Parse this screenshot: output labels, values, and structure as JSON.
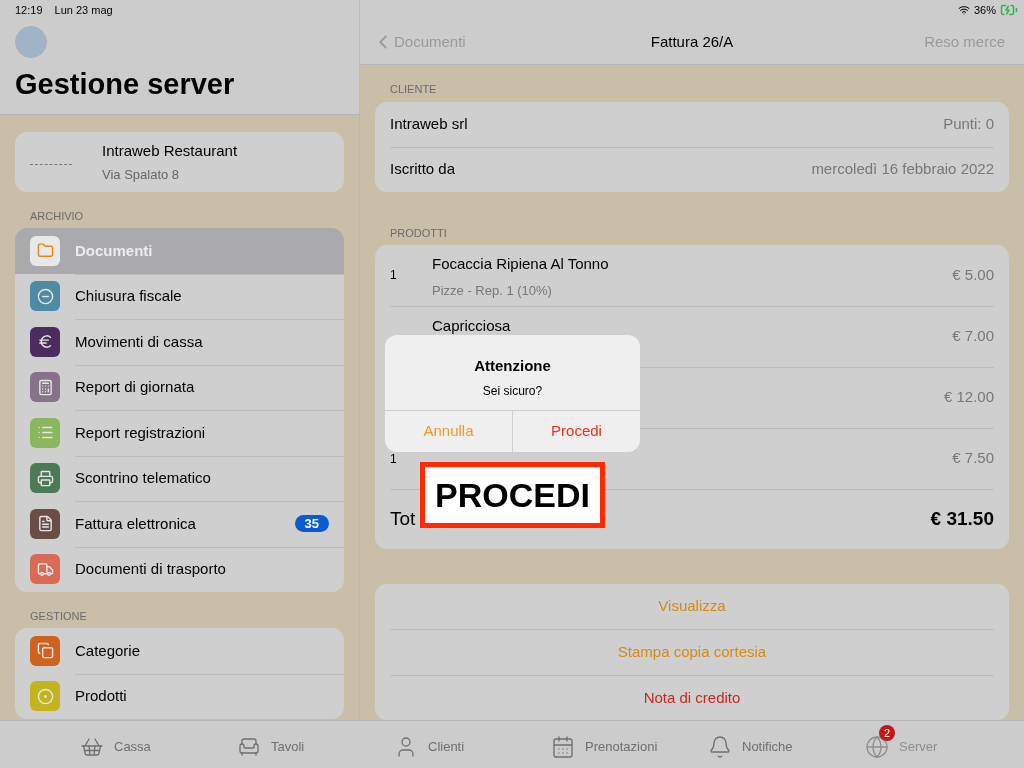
{
  "status_bar": {
    "time": "12:19",
    "date": "Lun 23 mag",
    "battery": "36%"
  },
  "sidebar": {
    "title": "Gestione server",
    "shop": {
      "name": "Intraweb Restaurant",
      "address": "Via Spalato 8"
    },
    "sections": [
      {
        "title": "ARCHIVIO",
        "items": [
          {
            "label": "Documenti",
            "selected": true,
            "color": "#e8e8e8"
          },
          {
            "label": "Chiusura fiscale",
            "selected": false,
            "color": "#4d8aa3"
          },
          {
            "label": "Movimenti di cassa",
            "selected": false,
            "color": "#4a2d5e"
          },
          {
            "label": "Report di giornata",
            "selected": false,
            "color": "#86738a"
          },
          {
            "label": "Report registrazioni",
            "selected": false,
            "color": "#8ab65e"
          },
          {
            "label": "Scontrino telematico",
            "selected": false,
            "color": "#4a7a56"
          },
          {
            "label": "Fattura elettronica",
            "selected": false,
            "color": "#6a4e45",
            "badge": "35"
          },
          {
            "label": "Documenti di trasporto",
            "selected": false,
            "color": "#d86a56"
          }
        ]
      },
      {
        "title": "GESTIONE",
        "items": [
          {
            "label": "Categorie",
            "selected": false,
            "color": "#d0621f"
          },
          {
            "label": "Prodotti",
            "selected": false,
            "color": "#c2b41c"
          }
        ]
      }
    ]
  },
  "nav": {
    "back": "Documenti",
    "title": "Fattura 26/A",
    "action": "Reso merce"
  },
  "cliente": {
    "title": "CLIENTE",
    "rows": [
      {
        "label": "Intraweb srl",
        "value": "Punti: 0"
      },
      {
        "label": "Iscritto da",
        "value": "mercoledì 16 febbraio 2022"
      }
    ]
  },
  "prodotti": {
    "title": "PRODOTTI",
    "rows": [
      {
        "qty": "1",
        "name": "Focaccia Ripiena Al Tonno",
        "detail": "Pizze - Rep. 1 (10%)",
        "price": "€ 5.00"
      },
      {
        "name": "Capricciosa",
        "price": "€ 7.00"
      },
      {
        "price": "€ 12.00"
      },
      {
        "qty": "1",
        "price": "€ 7.50"
      }
    ],
    "total_label": "Tot",
    "total": "€ 31.50"
  },
  "actions": [
    {
      "label": "Visualizza",
      "kind": "normal"
    },
    {
      "label": "Stampa copia cortesia",
      "kind": "normal"
    },
    {
      "label": "Nota di credito",
      "kind": "destructive"
    }
  ],
  "alert": {
    "title": "Attenzione",
    "message": "Sei sicuro?",
    "buttons": [
      {
        "label": "Annulla",
        "kind": "cancel"
      },
      {
        "label": "Procedi",
        "kind": "destructive"
      }
    ]
  },
  "callout": "PROCEDI",
  "tab_bar": [
    {
      "label": "Cassa",
      "selected": false
    },
    {
      "label": "Tavoli",
      "selected": false
    },
    {
      "label": "Clienti",
      "selected": false
    },
    {
      "label": "Prenotazioni",
      "selected": false
    },
    {
      "label": "Notifiche",
      "selected": false
    },
    {
      "label": "Server",
      "selected": true,
      "badge": "2"
    }
  ]
}
